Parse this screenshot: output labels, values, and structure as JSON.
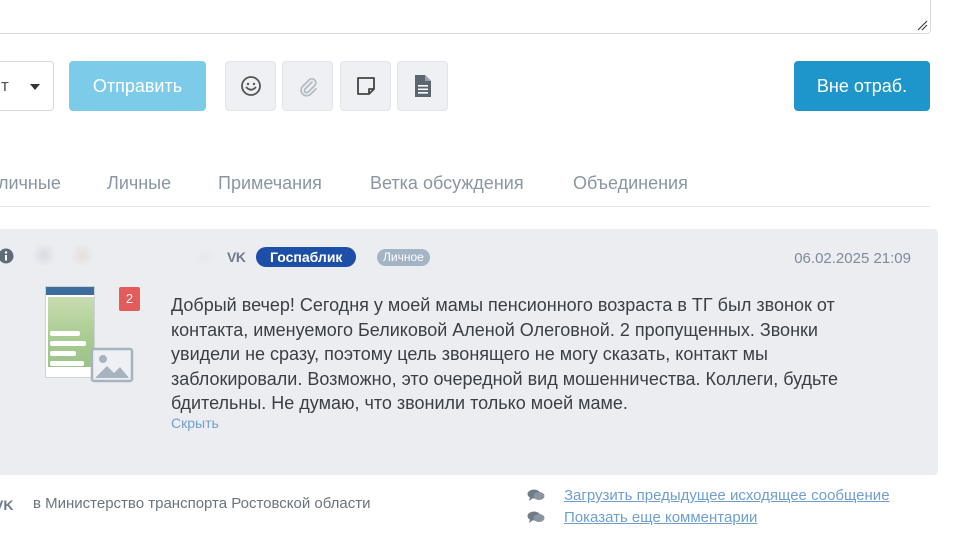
{
  "composer": {
    "select_value": "т",
    "send_label": "Отправить",
    "tools": [
      "emoji-icon",
      "paperclip-icon",
      "note-icon",
      "document-icon"
    ],
    "away_label": "Вне отраб."
  },
  "tabs": [
    "личные",
    "Личные",
    "Примечания",
    "Ветка обсуждения",
    "Объединения"
  ],
  "message": {
    "network": "VK",
    "badge": "Госпаблик",
    "type_badge": "Личное",
    "date": "06.02.2025 21:09",
    "attachment_count": "2",
    "text": "Добрый вечер! Сегодня у моей мамы пенсионного возраста в ТГ был звонок от контакта, именуемого Беликовой Аленой Олеговной. 2 пропущенных. Звонки увидели не сразу, поэтому цель звонящего не могу сказать, контакт мы заблокировали. Возможно, это очередной вид мошенничества. Коллеги, будьте бдительны. Не думаю, что звонили только моей маме.",
    "hide_link": "Скрыть"
  },
  "footer": {
    "network": "VK",
    "destination": "в Министерство транспорта Ростовской области",
    "load_previous": "Загрузить предыдущее исходящее сообщение",
    "show_more": "Показать еще комментарии"
  },
  "colors": {
    "send_button": "#7ccbe8",
    "away_button": "#1e96cc",
    "gospub_badge": "#1e4fa8",
    "personal_badge": "#a3b4c4",
    "count_badge": "#e35b5b",
    "link": "#6f9fcc"
  }
}
